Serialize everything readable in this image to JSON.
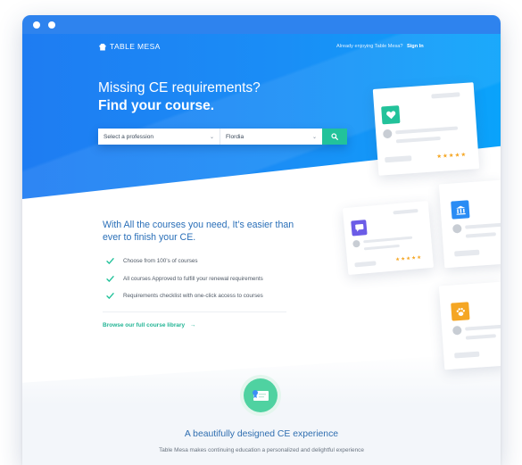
{
  "header": {
    "logo_text": "TABLE MESA",
    "signin_prompt": "Already enjoying Table Mesa?",
    "signin_label": "Sign In"
  },
  "hero": {
    "headline_line1": "Missing CE requirements?",
    "headline_line2": "Find your course."
  },
  "search": {
    "profession_value": "Select a profession",
    "state_value": "Flordia",
    "button_icon": "search-icon"
  },
  "intro": {
    "heading": "With All the courses you need, It’s easier than ever to finish your CE.",
    "items": [
      {
        "label": "Choose from 100’s of courses"
      },
      {
        "label": "All courses Approved to fulfill your renewal requirements"
      },
      {
        "label": "Requirements checklist with one-click access to courses"
      }
    ],
    "browse_link": "Browse our full course library",
    "browse_arrow": "→"
  },
  "cards": [
    {
      "icon": "heart-icon",
      "color": "#22c29a",
      "rating": "★★★★★"
    },
    {
      "icon": "chat-icon",
      "color": "#6b5ce7",
      "rating": "★★★★★"
    },
    {
      "icon": "bank-icon",
      "color": "#2a8cf4"
    },
    {
      "icon": "paw-icon",
      "color": "#f5a623"
    }
  ],
  "feature": {
    "icon": "certificate-icon",
    "title": "A beautifully designed CE experience",
    "description": "Table Mesa makes continuing education a personalized and delightful experience"
  },
  "colors": {
    "hero_blue": "#1e7cf2",
    "accent_green": "#22c29a",
    "heading_blue": "#2a6fb8"
  }
}
